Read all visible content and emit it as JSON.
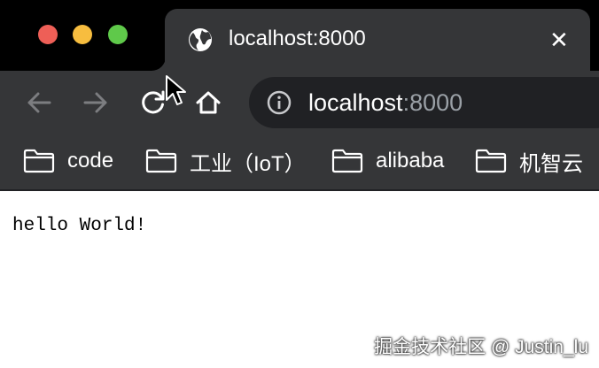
{
  "window": {
    "controls": [
      "close",
      "minimize",
      "zoom"
    ],
    "colors": {
      "close": "#ee5f57",
      "minimize": "#f7bd3f",
      "zoom": "#5fc94a"
    }
  },
  "tab": {
    "title": "localhost:8000",
    "icon": "globe-icon",
    "close_label": "✕"
  },
  "toolbar": {
    "back_icon": "back-arrow-icon",
    "forward_icon": "forward-arrow-icon",
    "reload_icon": "reload-icon",
    "home_icon": "home-icon"
  },
  "address": {
    "host": "localhost",
    "port": ":8000",
    "icon": "info-icon"
  },
  "bookmarks": [
    {
      "label": "code",
      "icon": "folder-icon"
    },
    {
      "label": "工业（IoT）",
      "icon": "folder-icon"
    },
    {
      "label": "alibaba",
      "icon": "folder-icon"
    },
    {
      "label": "机智云",
      "icon": "folder-icon"
    }
  ],
  "page": {
    "text": "hello World!"
  },
  "watermark": "掘金技术社区 @ Justin_lu"
}
